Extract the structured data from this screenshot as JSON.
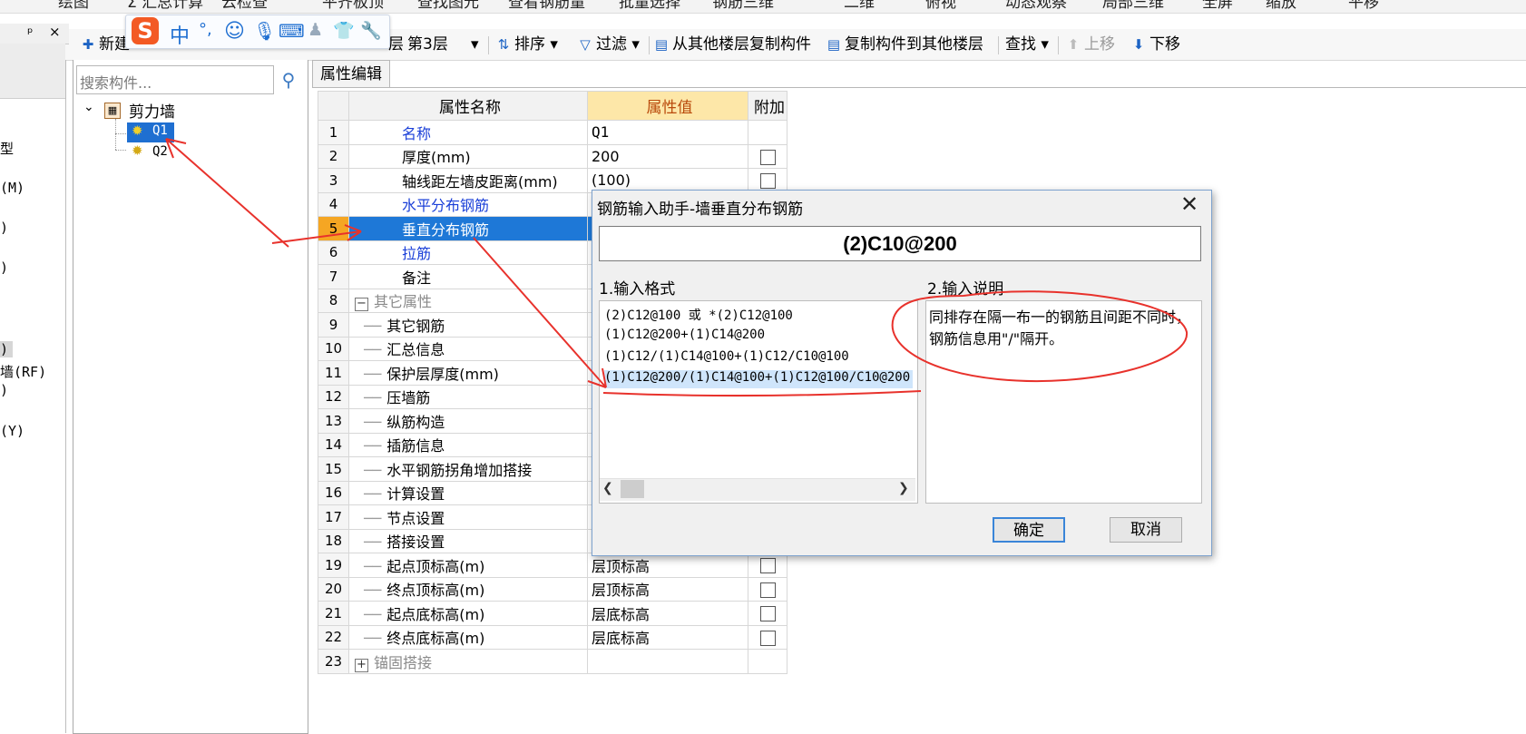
{
  "toolbar_top": {
    "items": [
      "绘图",
      "Σ 汇总计算",
      "云检查",
      "平齐板顶",
      "查找图元",
      "查看钢筋量",
      "批量选择",
      "钢筋三维",
      "二维",
      "俯视",
      "动态观察",
      "局部三维",
      "全屏",
      "缩放",
      "平移"
    ]
  },
  "toolbar": {
    "new_label": "新建",
    "layer_prefix": "层",
    "layer_value": "第3层",
    "sort_label": "排序",
    "filter_label": "过滤",
    "copy_from_label": "从其他楼层复制构件",
    "copy_to_label": "复制构件到其他楼层",
    "find_label": "查找",
    "move_up_label": "上移",
    "move_down_label": "下移"
  },
  "ime": {
    "logo": "S",
    "lang": "中"
  },
  "left_strip": {
    "pin": "ᵖ",
    "close": "×",
    "items": [
      "型",
      "(M)",
      ")",
      ")",
      ")",
      "墙(RF)",
      ")",
      "(Y)"
    ]
  },
  "tree": {
    "search_placeholder": "搜索构件...",
    "root": "剪力墙",
    "children": [
      "Q1",
      "Q2"
    ]
  },
  "props": {
    "tab": "属性编辑",
    "headers": [
      "属性名称",
      "属性值",
      "附加"
    ],
    "rows": [
      {
        "n": "1",
        "name": "名称",
        "value": "Q1",
        "style": "blue",
        "chk": false
      },
      {
        "n": "2",
        "name": "厚度(mm)",
        "value": "200",
        "style": "",
        "chk": true
      },
      {
        "n": "3",
        "name": "轴线距左墙皮距离(mm)",
        "value": "(100)",
        "style": "",
        "chk": true
      },
      {
        "n": "4",
        "name": "水平分布钢筋",
        "value": "",
        "style": "blue",
        "chk": false
      },
      {
        "n": "5",
        "name": "垂直分布钢筋",
        "value": "",
        "style": "sel",
        "chk": false
      },
      {
        "n": "6",
        "name": "拉筋",
        "value": "",
        "style": "blue",
        "chk": false
      },
      {
        "n": "7",
        "name": "备注",
        "value": "",
        "style": "",
        "chk": false
      },
      {
        "n": "8",
        "name": "其它属性",
        "value": "",
        "style": "group",
        "chk": false
      },
      {
        "n": "9",
        "name": "其它钢筋",
        "value": "",
        "style": "sub",
        "chk": false
      },
      {
        "n": "10",
        "name": "汇总信息",
        "value": "",
        "style": "sub",
        "chk": false
      },
      {
        "n": "11",
        "name": "保护层厚度(mm)",
        "value": "",
        "style": "sub",
        "chk": false
      },
      {
        "n": "12",
        "name": "压墙筋",
        "value": "",
        "style": "sub",
        "chk": false
      },
      {
        "n": "13",
        "name": "纵筋构造",
        "value": "",
        "style": "sub",
        "chk": false
      },
      {
        "n": "14",
        "name": "插筋信息",
        "value": "",
        "style": "sub",
        "chk": false
      },
      {
        "n": "15",
        "name": "水平钢筋拐角增加搭接",
        "value": "",
        "style": "sub",
        "chk": false
      },
      {
        "n": "16",
        "name": "计算设置",
        "value": "",
        "style": "sub",
        "chk": false
      },
      {
        "n": "17",
        "name": "节点设置",
        "value": "",
        "style": "sub",
        "chk": false
      },
      {
        "n": "18",
        "name": "搭接设置",
        "value": "",
        "style": "sub",
        "chk": false
      },
      {
        "n": "19",
        "name": "起点顶标高(m)",
        "value": "层顶标高",
        "style": "sub",
        "chk": true
      },
      {
        "n": "20",
        "name": "终点顶标高(m)",
        "value": "层顶标高",
        "style": "sub",
        "chk": true
      },
      {
        "n": "21",
        "name": "起点底标高(m)",
        "value": "层底标高",
        "style": "sub",
        "chk": true
      },
      {
        "n": "22",
        "name": "终点底标高(m)",
        "value": "层底标高",
        "style": "sub",
        "chk": true
      },
      {
        "n": "23",
        "name": "锚固搭接",
        "value": "",
        "style": "groupplus",
        "chk": false
      }
    ]
  },
  "dialog": {
    "title": "钢筋输入助手-墙垂直分布钢筋",
    "input_value": "(2)C10@200",
    "format_label": "1.输入格式",
    "desc_label": "2.输入说明",
    "formats": [
      "(2)C12@100 或 *(2)C12@100",
      "(1)C12@200+(1)C14@200",
      "(1)C12/(1)C14@100+(1)C12/C10@100",
      "(1)C12@200/(1)C14@100+(1)C12@100/C10@200"
    ],
    "selected_format_index": 3,
    "description": "同排存在隔一布一的钢筋且间距不同时，钢筋信息用\"/\"隔开。",
    "ok_label": "确定",
    "cancel_label": "取消"
  },
  "annotation_color": "#e8322c"
}
